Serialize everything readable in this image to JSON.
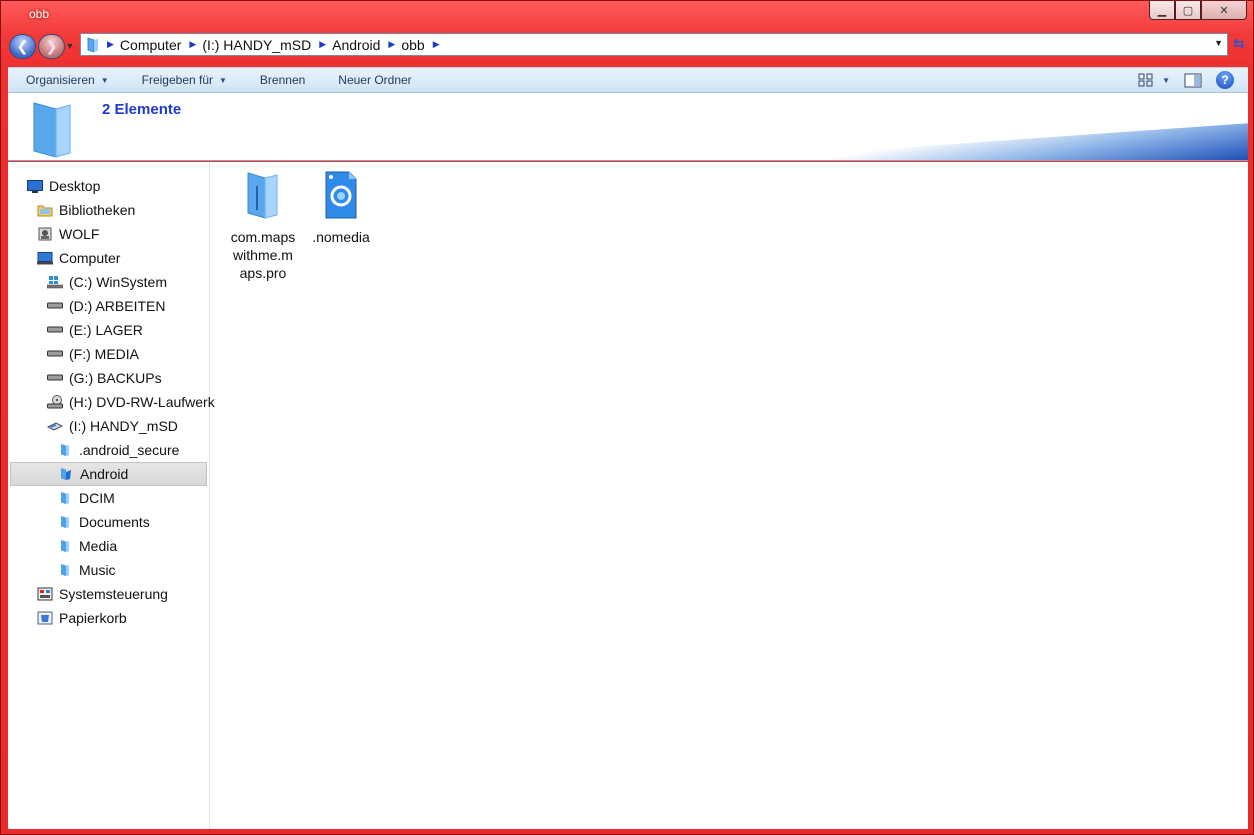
{
  "window": {
    "title": "obb"
  },
  "address": {
    "crumbs": [
      "Computer",
      "(I:) HANDY_mSD",
      "Android",
      "obb"
    ]
  },
  "toolbar": {
    "organize": "Organisieren",
    "share": "Freigeben für",
    "burn": "Brennen",
    "new_folder": "Neuer Ordner"
  },
  "infopane": {
    "item_count": "2 Elemente"
  },
  "navtree": {
    "desktop": "Desktop",
    "libraries": "Bibliotheken",
    "user": "WOLF",
    "computer": "Computer",
    "drive_c": "(C:) WinSystem",
    "drive_d": "(D:) ARBEITEN",
    "drive_e": "(E:) LAGER",
    "drive_f": "(F:) MEDIA",
    "drive_g": "(G:) BACKUPs",
    "drive_h": "(H:) DVD-RW-Laufwerk",
    "drive_i": "(I:) HANDY_mSD",
    "android_secure": ".android_secure",
    "android": "Android",
    "dcim": "DCIM",
    "documents": "Documents",
    "media": "Media",
    "music": "Music",
    "control_panel": "Systemsteuerung",
    "recycle_bin": "Papierkorb"
  },
  "files": [
    {
      "line1": "com.maps",
      "line2": "withme.m",
      "line3": "aps.pro"
    },
    {
      "line1": ".nomedia"
    }
  ]
}
